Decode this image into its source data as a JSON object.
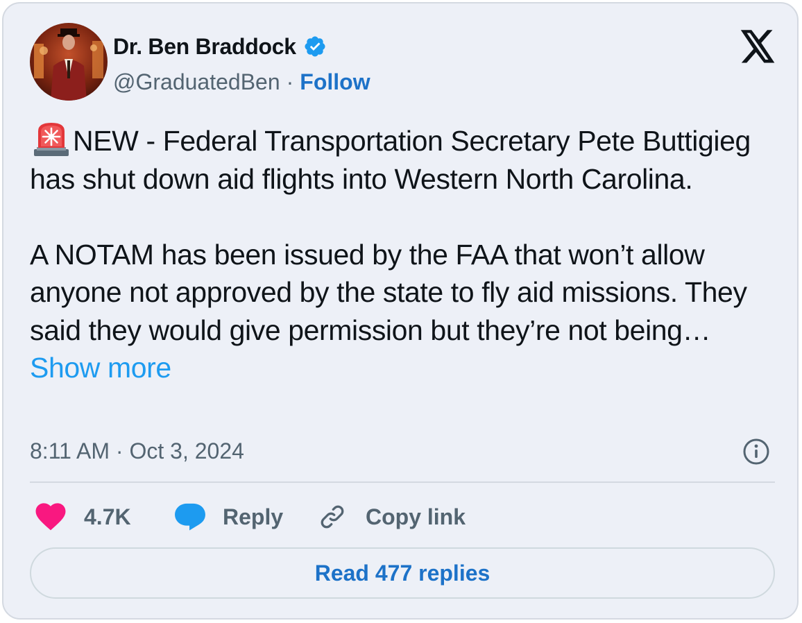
{
  "author": {
    "name": "Dr. Ben Braddock",
    "handle": "@GraduatedBen",
    "separator": "·",
    "follow_label": "Follow",
    "verified": true
  },
  "platform_icon": "x-logo-icon",
  "tweet": {
    "lead_emoji": "police-siren-icon",
    "paragraph1": "NEW - Federal Transportation Secretary Pete Buttigieg has shut down aid flights into Western North Carolina.",
    "paragraph2": "A NOTAM has been issued by the FAA that won’t allow anyone not approved by the state to fly aid missions. They said they would give permission but they’re not being…",
    "show_more": "Show more"
  },
  "timestamp": "8:11 AM · Oct 3, 2024",
  "actions": {
    "likes_count": "4.7K",
    "reply_label": "Reply",
    "copy_link_label": "Copy link"
  },
  "read_replies_label": "Read 477 replies",
  "colors": {
    "card_background": "#edf0f7",
    "link": "#1d72c8",
    "show_more": "#1d9bf0",
    "like": "#f91880",
    "reply": "#1d9bf0",
    "verified": "#1d9bf0",
    "text": "#0f1419",
    "muted": "#536471"
  }
}
